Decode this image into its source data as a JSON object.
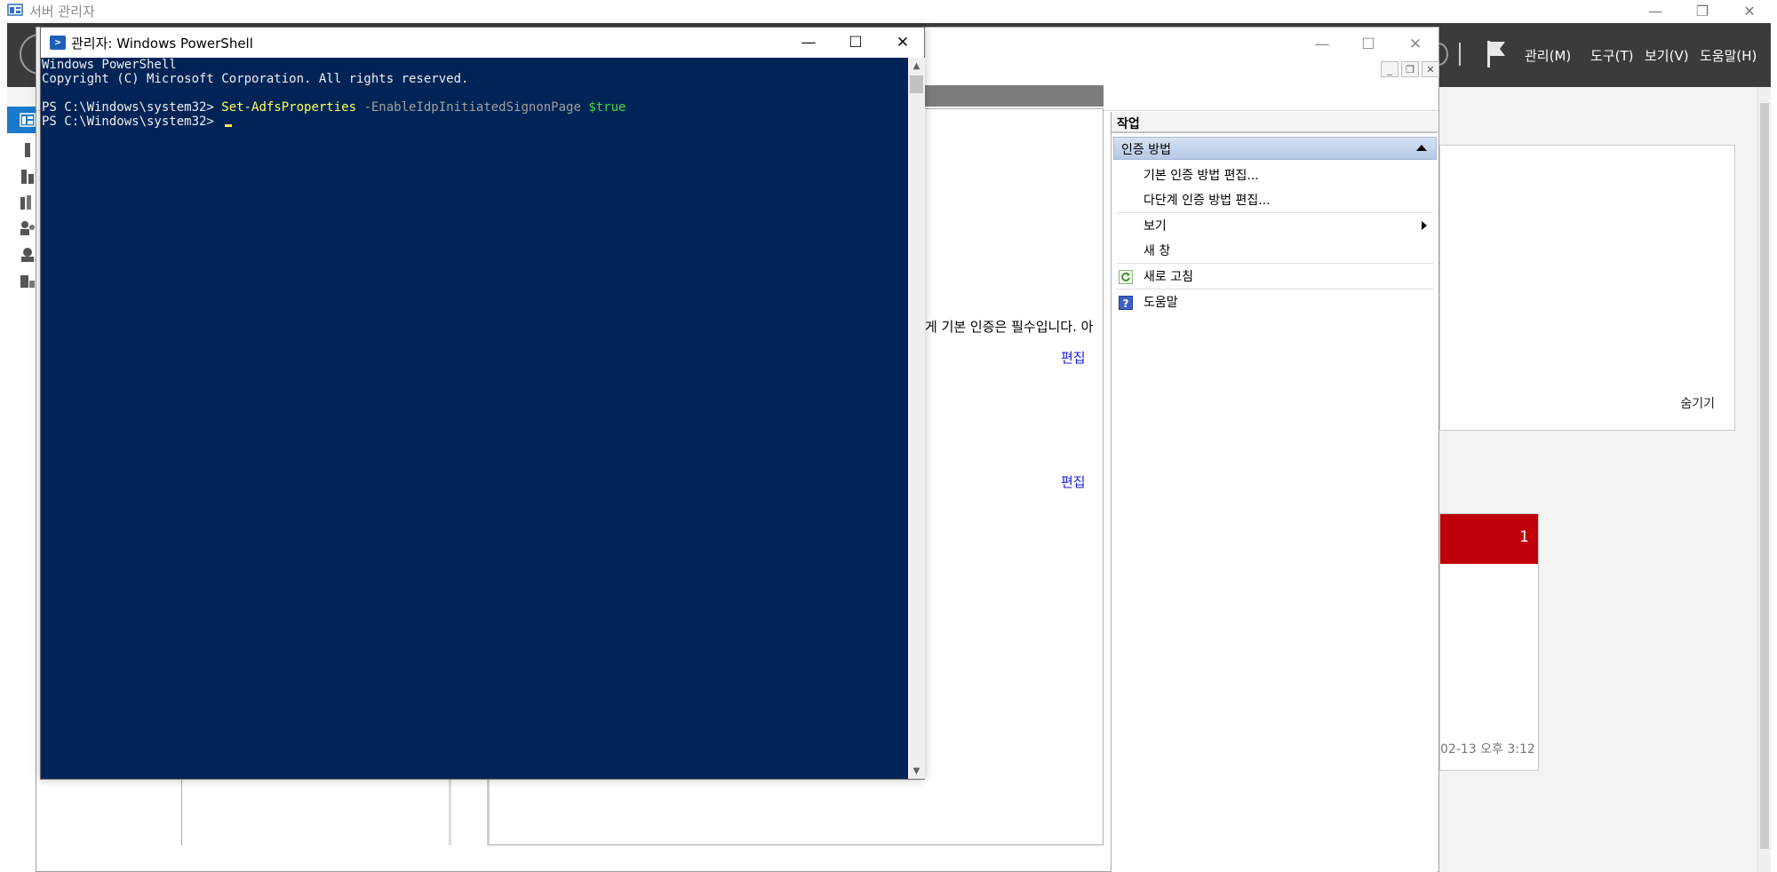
{
  "server_manager": {
    "title": "서버 관리자",
    "menus": [
      "관리(M)",
      "도구(T)",
      "보기(V)",
      "도움말(H)"
    ],
    "panel": {
      "hide_label": "숨기기"
    },
    "tile": {
      "count": "1",
      "timestamp": "02-13 오후 3:12"
    },
    "colors": {
      "header": "#3b3b3b",
      "nav_selected": "#1979ca",
      "tile_alert": "#c0000a"
    }
  },
  "adfs": {
    "center": {
      "description": "게 기본 인증은 필수입니다. 아",
      "edit_links": [
        "편집",
        "편집"
      ]
    },
    "actions": {
      "header": "작업",
      "group": "인증 방법",
      "items": [
        {
          "label": "기본 인증 방법 편집...",
          "icon": ""
        },
        {
          "label": "다단계 인증 방법 편집...",
          "icon": ""
        },
        {
          "label": "보기",
          "icon": "submenu-arrow"
        },
        {
          "label": "새 창",
          "icon": ""
        },
        {
          "label": "새로 고침",
          "icon": "refresh-icon"
        },
        {
          "label": "도움말",
          "icon": "help-icon"
        }
      ]
    }
  },
  "powershell": {
    "title": "관리자: Windows PowerShell",
    "lines": [
      "Windows PowerShell",
      "Copyright (C) Microsoft Corporation. All rights reserved.",
      ""
    ],
    "command": {
      "prompt": "PS C:\\Windows\\system32> ",
      "name": "Set-AdfsProperties",
      "param": "-EnableIdpInitiatedSignonPage",
      "value": "$true"
    },
    "current_prompt": "PS C:\\Windows\\system32> ",
    "colors": {
      "background": "#012456",
      "command": "#ffff55",
      "parameter": "#a0a0a0",
      "value": "#3edb3e"
    }
  }
}
